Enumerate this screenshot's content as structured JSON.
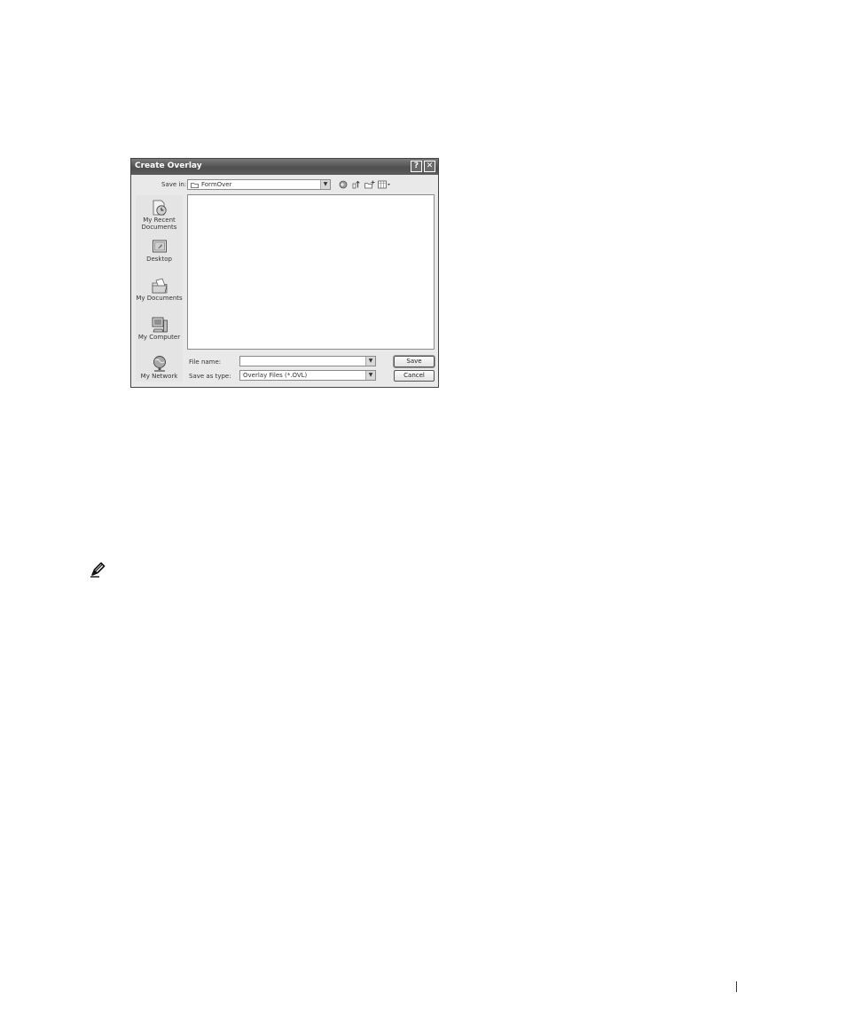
{
  "dialog": {
    "title": "Create Overlay",
    "help_glyph": "?",
    "close_glyph": "✕"
  },
  "toolbar": {
    "save_in_label": "Save in:",
    "save_in_value": "FormOver",
    "icons": [
      "back-icon",
      "up-folder-icon",
      "new-folder-icon",
      "views-menu-icon"
    ]
  },
  "places": [
    {
      "label_lines": [
        "My Recent",
        "Documents"
      ],
      "icon": "recent-documents-icon"
    },
    {
      "label_lines": [
        "Desktop"
      ],
      "icon": "desktop-icon"
    },
    {
      "label_lines": [
        "My Documents"
      ],
      "icon": "my-documents-icon"
    },
    {
      "label_lines": [
        "My Computer"
      ],
      "icon": "my-computer-icon"
    },
    {
      "label_lines": [
        "My Network"
      ],
      "icon": "my-network-icon"
    }
  ],
  "file_name": {
    "label": "File name:",
    "value": ""
  },
  "save_as_type": {
    "label": "Save as type:",
    "value": "Overlay Files (*.OVL)"
  },
  "buttons": {
    "save": "Save",
    "cancel": "Cancel"
  },
  "colors": {
    "titlebar": "#5c5c5c",
    "dialog_bg": "#e9e9e9",
    "places_bg": "#e4e4e4"
  }
}
